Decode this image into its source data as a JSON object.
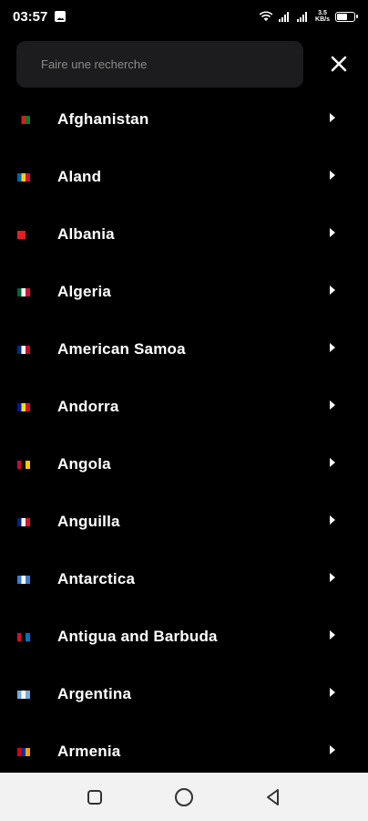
{
  "status": {
    "time": "03:57",
    "speed_value": "3.5",
    "speed_unit": "KB/s"
  },
  "search": {
    "placeholder": "Faire une recherche",
    "value": ""
  },
  "icons": {
    "close": "close-icon",
    "chevron": "chevron-right-icon",
    "recents": "square-icon",
    "home": "circle-icon",
    "back": "triangle-back-icon"
  },
  "countries": [
    {
      "name": "Afghanistan",
      "flag": [
        "#000000",
        "#d32011",
        "#007a36"
      ]
    },
    {
      "name": "Aland",
      "flag": [
        "#0064ae",
        "#ffce00",
        "#d21034"
      ]
    },
    {
      "name": "Albania",
      "flag": [
        "#e41e20",
        "#e41e20",
        "#000000"
      ]
    },
    {
      "name": "Algeria",
      "flag": [
        "#006233",
        "#ffffff",
        "#d21034"
      ]
    },
    {
      "name": "American Samoa",
      "flag": [
        "#002b7f",
        "#ffffff",
        "#bf0a30"
      ]
    },
    {
      "name": "Andorra",
      "flag": [
        "#0018a8",
        "#fedf00",
        "#d0103a"
      ]
    },
    {
      "name": "Angola",
      "flag": [
        "#cc092f",
        "#000000",
        "#ffcb00"
      ]
    },
    {
      "name": "Anguilla",
      "flag": [
        "#00247d",
        "#ffffff",
        "#cf142b"
      ]
    },
    {
      "name": "Antarctica",
      "flag": [
        "#3a7dce",
        "#ffffff",
        "#3a7dce"
      ]
    },
    {
      "name": "Antigua and Barbuda",
      "flag": [
        "#ce1126",
        "#000000",
        "#0072c6"
      ]
    },
    {
      "name": "Argentina",
      "flag": [
        "#74acdf",
        "#ffffff",
        "#74acdf"
      ]
    },
    {
      "name": "Armenia",
      "flag": [
        "#d90012",
        "#0033a0",
        "#f2a800"
      ]
    }
  ]
}
